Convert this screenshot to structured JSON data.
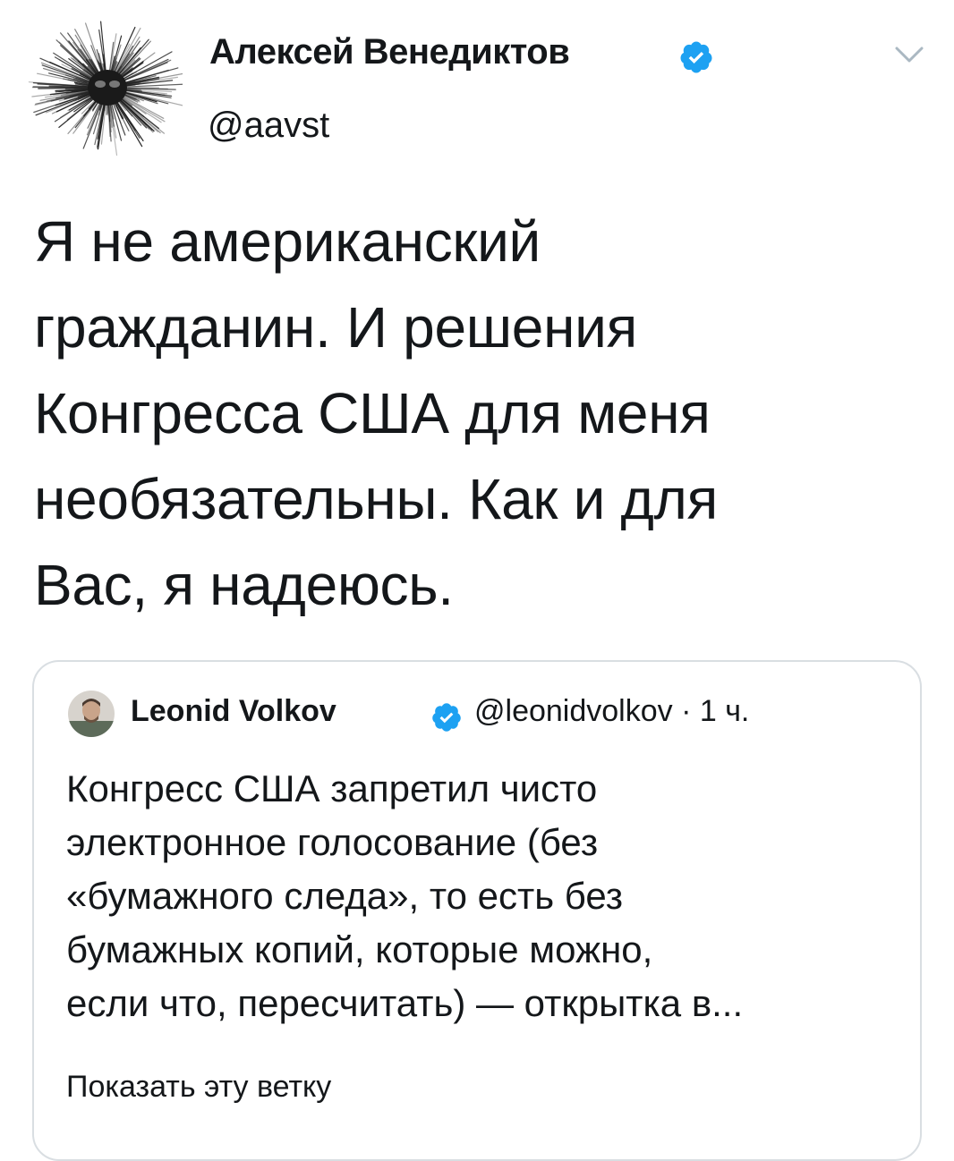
{
  "tweet": {
    "author_name": "Алексей Венедиктов",
    "handle": "@aavst",
    "text_lines": [
      "Я не американский",
      "гражданин. И решения",
      "Конгресса США для меня",
      "необязательны. Как и для",
      "Вас, я надеюсь."
    ]
  },
  "quote": {
    "author_name": "Leonid Volkov",
    "handle_time": "@leonidvolkov · 1 ч.",
    "text_lines": [
      "Конгресс США запретил чисто",
      "электронное голосование (без",
      "«бумажного следа», то есть без",
      "бумажных копий, которые можно,",
      "если что, пересчитать) — открытка в..."
    ],
    "show_thread": "Показать эту ветку"
  },
  "icons": {
    "verified": "verified-badge-icon",
    "chevron": "chevron-down-icon"
  },
  "colors": {
    "verified_blue": "#1da1f2",
    "text": "#14171a",
    "chevron": "#aab8c2",
    "card_border": "#d9dee2"
  }
}
